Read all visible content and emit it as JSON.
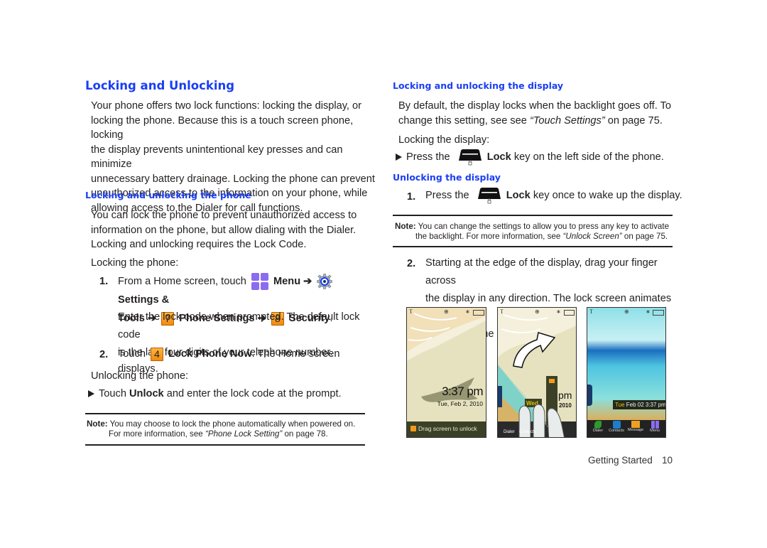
{
  "left": {
    "title": "Locking and Unlocking",
    "intro": [
      "Your phone offers two lock functions: locking the display, or",
      "locking the phone. Because this is a touch screen phone, locking",
      "the display prevents unintentional key presses and can minimize",
      "unnecessary battery drainage.  Locking the phone can prevent",
      "unauthorized access to the information on your phone, while",
      "allowing access to the Dialer for call functions."
    ],
    "sub_heading": "Locking and unlocking the phone",
    "para": [
      "You can lock the phone to prevent unauthorized access to",
      "information on the phone, but allow dialing with the Dialer.",
      "Locking and unlocking requires the Lock Code."
    ],
    "locking_label": "Locking the phone:",
    "step1": {
      "num": "1.",
      "t1": "From a Home screen, touch",
      "menu": "Menu",
      "arrow": "➔",
      "settings": "Settings &",
      "tools": "Tools",
      "key7": "7",
      "phone_settings": "Phone Settings",
      "key8": "8",
      "security": "Security",
      "period": "."
    },
    "step1_sub": [
      "Enter the lock code when prompted. The default lock code",
      "is the last four digits of your telephone number."
    ],
    "step2": {
      "num": "2.",
      "t1": "Touch",
      "key4": "4",
      "bold": "Lock Phone Now",
      "t2": ". The Home screen displays."
    },
    "unlocking_label": "Unlocking the phone:",
    "bullet": {
      "t1": "Touch",
      "bold": "Unlock",
      "t2": "and enter the lock code at the prompt."
    },
    "note": {
      "label": "Note:",
      "line1": "You may choose to lock the phone automatically when powered on.",
      "line2a": "For more information, see",
      "link": "“Phone Lock Setting”",
      "line2b": "on page 78."
    }
  },
  "right": {
    "sub_heading1": "Locking and unlocking the display",
    "para1": {
      "line1": "By default, the display locks when the backlight goes off. To",
      "line2a": "change this setting, see see",
      "link": "“Touch Settings”",
      "line2b": "on page 75."
    },
    "locking_label": "Locking the display:",
    "bullet": {
      "t1": "Press the",
      "bold": "Lock",
      "t2": "key on the left side of the phone."
    },
    "sub_heading2": "Unlocking the display",
    "step1": {
      "num": "1.",
      "t1": "Press the",
      "bold": "Lock",
      "t2": "key once to wake up the display."
    },
    "note": {
      "label": "Note:",
      "line1": "You can change the settings to allow you to press any key to activate",
      "line2a": "the backlight. For more information, see",
      "link": "“Unlock Screen”",
      "line2b": "on page 75."
    },
    "step2": {
      "num": "2.",
      "lines": [
        "Starting at the edge of the display, drag your finger across",
        "the display in any direction. The lock screen animates and",
        "clears from the display."
      ]
    },
    "screens": {
      "s1": {
        "time": "3:37 pm",
        "date": "Tue, Feb 2, 2010",
        "unlock": "Drag screen to unlock"
      },
      "s2": {
        "day": "Wed",
        "time_partial": "pm",
        "year": "2010",
        "dock": [
          "Dialer",
          "Contacts"
        ]
      },
      "s3": {
        "day": "Tue",
        "date": "Feb 02",
        "time": "3:37",
        "ampm": "pm",
        "dock": [
          "Dialer",
          "Contacts",
          "Message",
          "Menu"
        ]
      }
    }
  },
  "footer": {
    "section": "Getting Started",
    "page": "10"
  },
  "colors": {
    "heading": "#1a3ef5",
    "key_orange": "#f59a1e",
    "menu_purple": "#8a6cf0"
  }
}
